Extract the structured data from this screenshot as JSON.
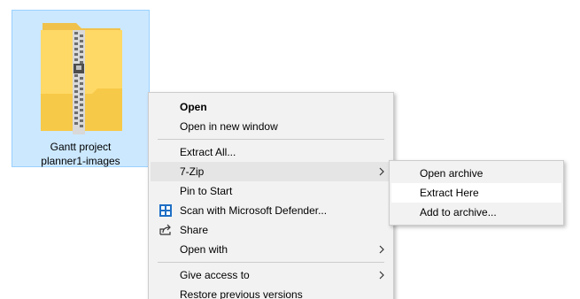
{
  "file": {
    "name_line1": "Gantt project",
    "name_line2": "planner1-images",
    "icon": "zip-folder-icon"
  },
  "context_menu": {
    "items": [
      {
        "label": "Open",
        "bold": true
      },
      {
        "label": "Open in new window"
      },
      {
        "label": "Extract All..."
      },
      {
        "label": "7-Zip",
        "submenu": true,
        "highlighted": true
      },
      {
        "label": "Pin to Start"
      },
      {
        "label": "Scan with Microsoft Defender...",
        "icon": "defender-shield-icon"
      },
      {
        "label": "Share",
        "icon": "share-icon"
      },
      {
        "label": "Open with",
        "submenu": true
      },
      {
        "label": "Give access to",
        "submenu": true
      },
      {
        "label": "Restore previous versions"
      }
    ]
  },
  "submenu_7zip": {
    "items": [
      {
        "label": "Open archive"
      },
      {
        "label": "Extract Here",
        "highlighted": true
      },
      {
        "label": "Add to archive..."
      }
    ]
  },
  "colors": {
    "selection_bg": "#cce8ff",
    "selection_border": "#99d1ff",
    "menu_bg": "#f2f2f2",
    "menu_hover": "#e5e5e5",
    "folder_yellow": "#ffd75e",
    "defender_blue": "#1f6fc5"
  }
}
